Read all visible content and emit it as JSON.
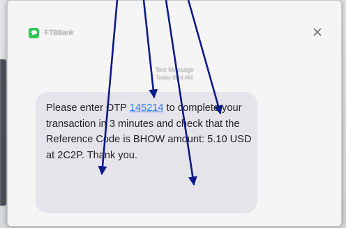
{
  "notification": {
    "app_icon": "message-bubble-icon",
    "app_name": "FTBBank",
    "close_icon": "close-x-icon"
  },
  "message_meta": {
    "type_label": "Text Message",
    "time_label": "Today 09:4 AM"
  },
  "message": {
    "before_otp": "Please enter OTP ",
    "otp": "145214",
    "after_otp": " to complete your transaction in 3 minutes and check that the Reference Code is BHOW amount: 5.10 USD at 2C2P. Thank you."
  },
  "annotations": {
    "arrow_color": "#0d1a86",
    "arrow_count": 4
  },
  "colors": {
    "bubble": "#e4e4ea",
    "link": "#2f7cf6",
    "app_icon": "#2fc457"
  }
}
